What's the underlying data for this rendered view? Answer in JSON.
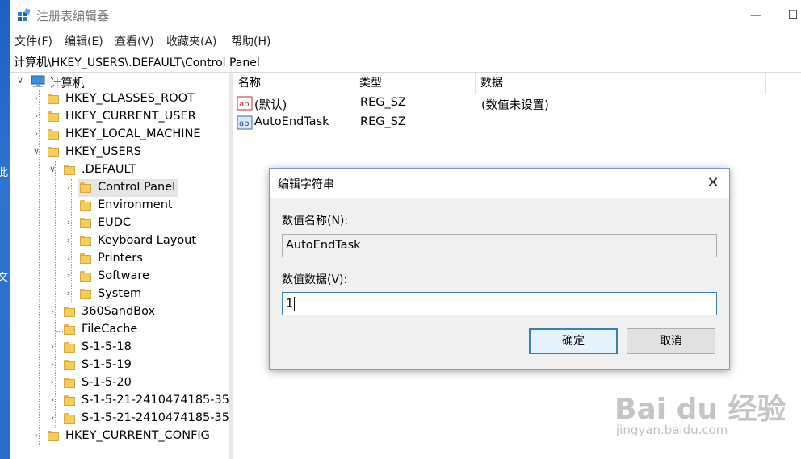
{
  "desktop": {
    "chars": [
      "此",
      "文"
    ]
  },
  "window": {
    "title": "注册表编辑器",
    "controls": {
      "minimize": "—",
      "maximize": "☐"
    }
  },
  "menu": [
    "文件(F)",
    "编辑(E)",
    "查看(V)",
    "收藏夹(A)",
    "帮助(H)"
  ],
  "address": "计算机\\HKEY_USERS\\.DEFAULT\\Control Panel",
  "tree": {
    "root": "计算机",
    "items": [
      "HKEY_CLASSES_ROOT",
      "HKEY_CURRENT_USER",
      "HKEY_LOCAL_MACHINE",
      "HKEY_USERS",
      ".DEFAULT",
      "Control Panel",
      "Environment",
      "EUDC",
      "Keyboard Layout",
      "Printers",
      "Software",
      "System",
      "360SandBox",
      "FileCache",
      "S-1-5-18",
      "S-1-5-19",
      "S-1-5-20",
      "S-1-5-21-2410474185-35",
      "S-1-5-21-2410474185-35",
      "HKEY_CURRENT_CONFIG"
    ]
  },
  "list": {
    "columns": [
      "名称",
      "类型",
      "数据"
    ],
    "rows": [
      {
        "name": "(默认)",
        "type": "REG_SZ",
        "data": "(数值未设置)"
      },
      {
        "name": "AutoEndTask",
        "type": "REG_SZ",
        "data": ""
      }
    ]
  },
  "dialog": {
    "title": "编辑字符串",
    "close": "✕",
    "name_label": "数值名称(N):",
    "name_value": "AutoEndTask",
    "data_label": "数值数据(V):",
    "data_value": "1",
    "ok": "确定",
    "cancel": "取消"
  },
  "watermark": {
    "main": "Bai du 经验",
    "sub": "jingyan.baidu.com"
  },
  "colors": {
    "accent": "#3c7fb1",
    "folder": "#f5cd5b",
    "selection": "#e5e5e5"
  }
}
